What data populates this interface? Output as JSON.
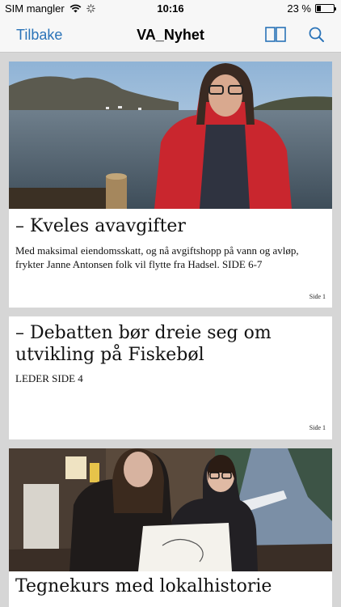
{
  "status_bar": {
    "carrier": "SIM mangler",
    "time": "10:16",
    "battery_percent": "23 %",
    "battery_level": 0.23
  },
  "nav": {
    "back_label": "Tilbake",
    "title": "VA_Nyhet",
    "layout_icon": "two-page-icon",
    "search_icon": "search-icon"
  },
  "articles": [
    {
      "headline": "– Kveles avavgifter",
      "lead": "Med maksimal eiendomsskatt, og nå avgiftshopp på vann og avløp, frykter Janne Antonsen folk vil flytte fra Hadsel. SIDE 6-7",
      "page": "Side 1"
    },
    {
      "headline": "– Debatten bør dreie seg om utvikling på Fiskebøl",
      "lead": "LEDER SIDE 4",
      "page": "Side 1"
    },
    {
      "headline": "Tegnekurs med lokalhistorie",
      "lead": "",
      "page": ""
    }
  ],
  "colors": {
    "accent": "#2a73b8",
    "background": "#d6d6d6",
    "card": "#ffffff",
    "bar": "#f7f7f7"
  }
}
